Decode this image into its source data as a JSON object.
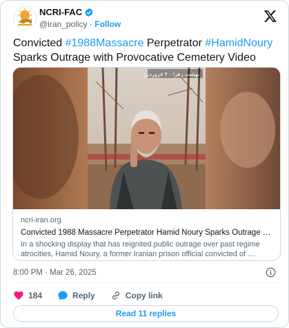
{
  "author": {
    "name": "NCRI-FAC",
    "handle": "@iran_policy",
    "separator": "·",
    "follow_label": "Follow"
  },
  "tweet": {
    "text_1": "Convicted ",
    "hashtag_1": "#1988Massacre",
    "text_2": " Perpetrator ",
    "hashtag_2": "#HamidNoury",
    "text_3": " Sparks Outrage with Provocative Cemetery Video"
  },
  "link_card": {
    "video_overlay": "بهشت زهرا - ۴ فروردین",
    "domain": "ncri-iran.org",
    "title": "Convicted 1988 Massacre Perpetrator Hamid Noury Sparks Outrage wit…",
    "description_line1": "In a shocking display that has reignited public outrage over past regime",
    "description_line2": "atrocities, Hamid Noury, a former Iranian prison official convicted of …"
  },
  "timestamp": "8:00 PM · Mar 26, 2025",
  "actions": {
    "like_count": "184",
    "reply_label": "Reply",
    "copy_link_label": "Copy link"
  },
  "read_replies_label": "Read 11 replies",
  "colors": {
    "accent": "#1d9bf0",
    "like": "#f91880",
    "secondary_text": "#536471",
    "border": "#cfd9de"
  }
}
